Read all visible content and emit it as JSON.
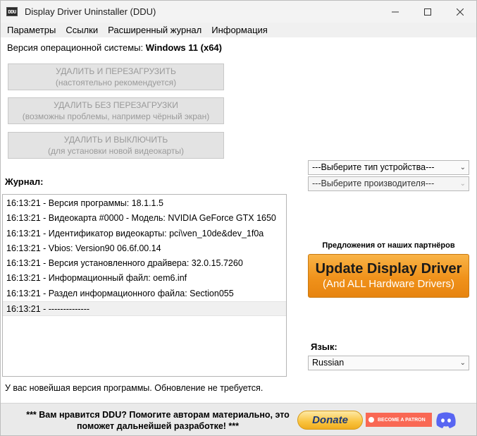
{
  "window": {
    "title": "Display Driver Uninstaller (DDU)",
    "icon_text": "DDU"
  },
  "menu": [
    "Параметры",
    "Ссылки",
    "Расширенный журнал",
    "Информация"
  ],
  "os": {
    "label": "Версия операционной системы:",
    "value": "Windows 11 (x64)"
  },
  "actions": [
    {
      "line1": "УДАЛИТЬ И ПЕРЕЗАГРУЗИТЬ",
      "line2": "(настоятельно рекомендуется)"
    },
    {
      "line1": "УДАЛИТЬ БЕЗ ПЕРЕЗАГРУЗКИ",
      "line2": "(возможны проблемы, например чёрный экран)"
    },
    {
      "line1": "УДАЛИТЬ И ВЫКЛЮЧИТЬ",
      "line2": "(для установки новой видеокарты)"
    }
  ],
  "journal": {
    "label": "Журнал:",
    "entries": [
      "16:13:21 - Версия программы: 18.1.1.5",
      "16:13:21 - Видеокарта #0000 - Модель: NVIDIA GeForce GTX 1650",
      "16:13:21 - Идентификатор видеокарты: pci\\ven_10de&dev_1f0a",
      "16:13:21 - Vbios: Version90 06.6f.00.14",
      "16:13:21 - Версия установленного драйвера: 32.0.15.7260",
      "16:13:21 - Информационный файл: oem6.inf",
      "16:13:21 - Раздел информационного файла: Section055",
      "16:13:21 - --------------"
    ]
  },
  "status": "У вас новейшая версия программы. Обновление не требуется.",
  "device_type_select": {
    "value": "---Выберите тип устройства---"
  },
  "vendor_select": {
    "value": "---Выберите производителя---"
  },
  "partners": {
    "label": "Предложения от наших партнёров",
    "ad_main": "Update Display Driver",
    "ad_sub": "(And ALL Hardware Drivers)"
  },
  "language": {
    "label": "Язык:",
    "value": "Russian"
  },
  "footer": {
    "line1": "*** Вам нравится DDU? Помогите авторам материально, это",
    "line2": "поможет дальнейшей разработке! ***",
    "donate": "Donate",
    "patron": "BECOME A PATRON"
  },
  "colors": {
    "accent_orange": "#f0921b",
    "patreon": "#f96854",
    "discord": "#5865f2"
  }
}
